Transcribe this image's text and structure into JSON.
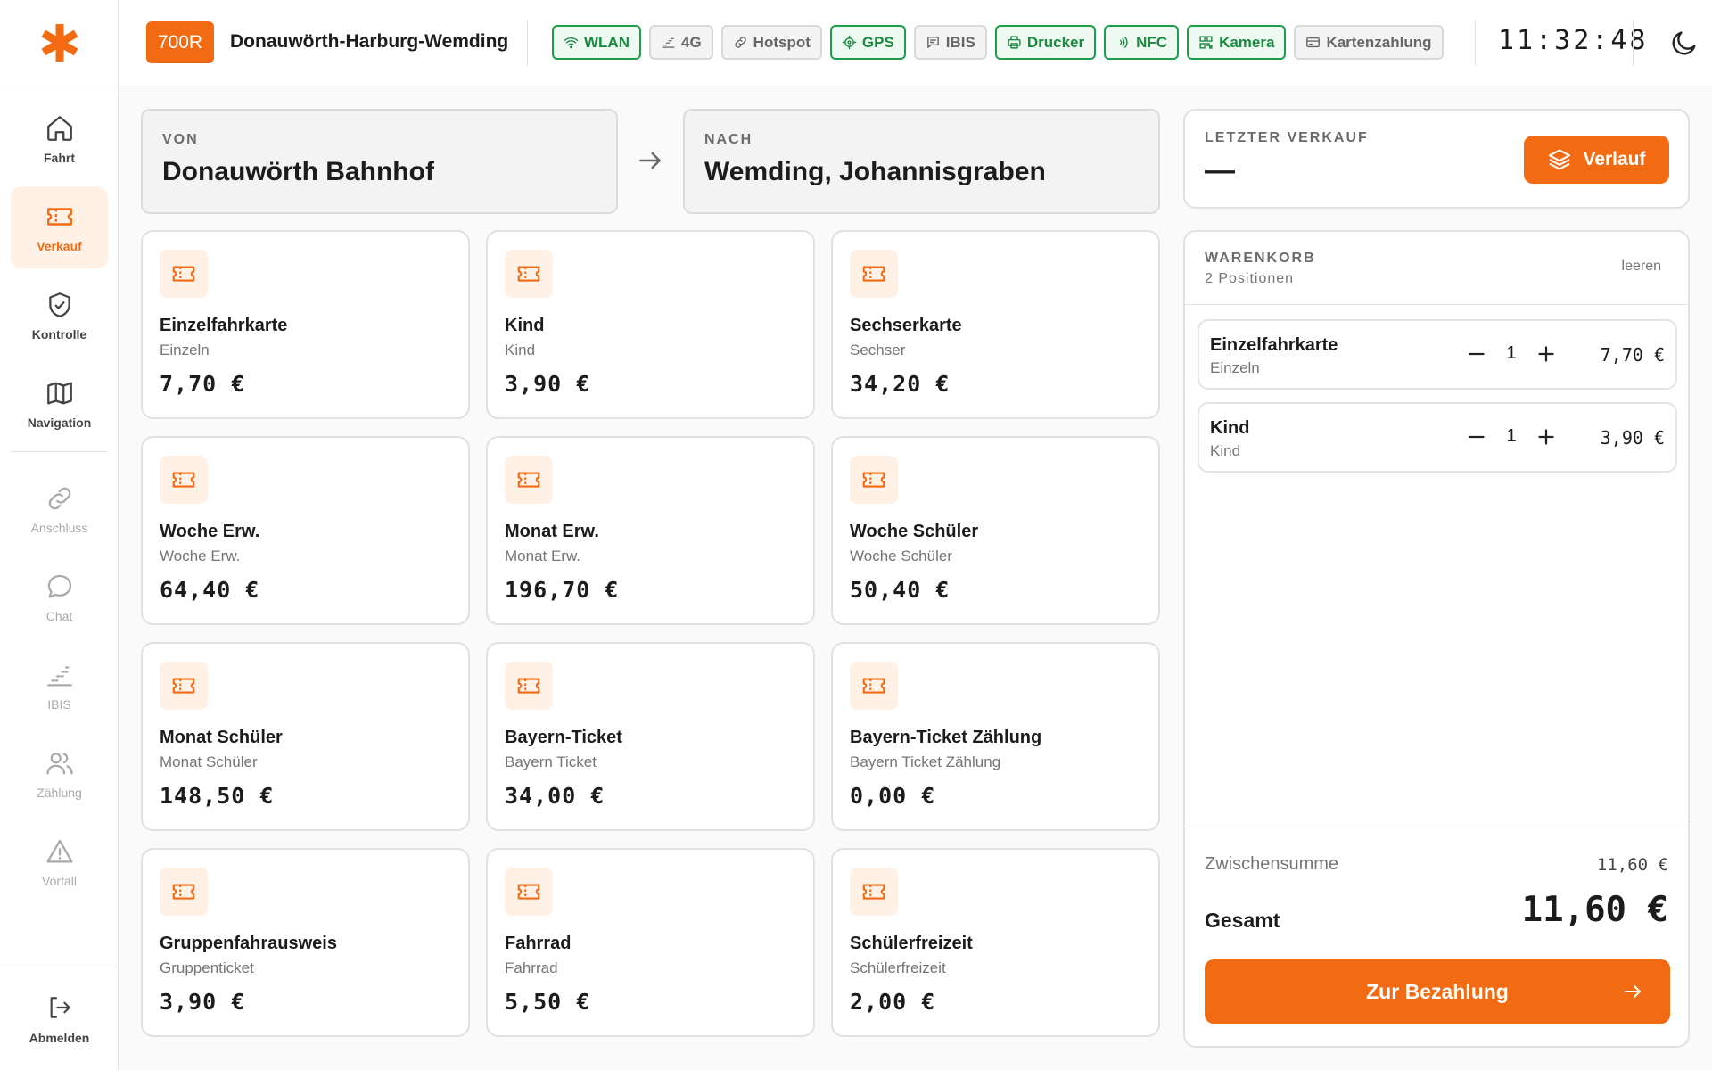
{
  "sidebar": {
    "items": [
      {
        "label": "Fahrt",
        "icon": "home-icon"
      },
      {
        "label": "Verkauf",
        "icon": "ticket-icon"
      },
      {
        "label": "Kontrolle",
        "icon": "shield-check-icon"
      },
      {
        "label": "Navigation",
        "icon": "map-icon"
      },
      {
        "label": "Anschluss",
        "icon": "link-icon"
      },
      {
        "label": "Chat",
        "icon": "chat-bubble-icon"
      },
      {
        "label": "IBIS",
        "icon": "signal-icon"
      },
      {
        "label": "Zählung",
        "icon": "users-icon"
      },
      {
        "label": "Vorfall",
        "icon": "warning-icon"
      }
    ],
    "logout": "Abmelden"
  },
  "header": {
    "line": "700R",
    "route": "Donauwörth-Harburg-Wemding",
    "status": [
      {
        "label": "WLAN",
        "on": true,
        "icon": "wifi-icon"
      },
      {
        "label": "4G",
        "on": false,
        "icon": "signal-bars-icon"
      },
      {
        "label": "Hotspot",
        "on": false,
        "icon": "link-icon"
      },
      {
        "label": "GPS",
        "on": true,
        "icon": "crosshair-icon"
      },
      {
        "label": "IBIS",
        "on": false,
        "icon": "message-icon"
      },
      {
        "label": "Drucker",
        "on": true,
        "icon": "printer-icon"
      },
      {
        "label": "NFC",
        "on": true,
        "icon": "nfc-icon"
      },
      {
        "label": "Kamera",
        "on": true,
        "icon": "qr-icon"
      },
      {
        "label": "Kartenzahlung",
        "on": false,
        "icon": "card-icon"
      }
    ],
    "clock": "11:32:48"
  },
  "route": {
    "from_label": "VON",
    "from": "Donauwörth Bahnhof",
    "to_label": "NACH",
    "to": "Wemding, Johannisgraben"
  },
  "tickets": [
    {
      "name": "Einzelfahrkarte",
      "sub": "Einzeln",
      "price": "7,70 €"
    },
    {
      "name": "Kind",
      "sub": "Kind",
      "price": "3,90 €"
    },
    {
      "name": "Sechserkarte",
      "sub": "Sechser",
      "price": "34,20 €"
    },
    {
      "name": "Woche Erw.",
      "sub": "Woche Erw.",
      "price": "64,40 €"
    },
    {
      "name": "Monat Erw.",
      "sub": "Monat Erw.",
      "price": "196,70 €"
    },
    {
      "name": "Woche Schüler",
      "sub": "Woche Schüler",
      "price": "50,40 €"
    },
    {
      "name": "Monat Schüler",
      "sub": "Monat Schüler",
      "price": "148,50 €"
    },
    {
      "name": "Bayern-Ticket",
      "sub": "Bayern Ticket",
      "price": "34,00 €"
    },
    {
      "name": "Bayern-Ticket Zählung",
      "sub": "Bayern Ticket Zählung",
      "price": "0,00 €"
    },
    {
      "name": "Gruppenfahrausweis",
      "sub": "Gruppenticket",
      "price": "3,90 €"
    },
    {
      "name": "Fahrrad",
      "sub": "Fahrrad",
      "price": "5,50 €"
    },
    {
      "name": "Schülerfreizeit",
      "sub": "Schülerfreizeit",
      "price": "2,00 €"
    }
  ],
  "last_sale": {
    "label": "LETZTER VERKAUF",
    "value": "—",
    "history_button": "Verlauf"
  },
  "cart": {
    "title": "WARENKORB",
    "count": "2 Positionen",
    "clear": "leeren",
    "items": [
      {
        "name": "Einzelfahrkarte",
        "sub": "Einzeln",
        "qty": "1",
        "price": "7,70 €"
      },
      {
        "name": "Kind",
        "sub": "Kind",
        "qty": "1",
        "price": "3,90 €"
      }
    ],
    "subtotal_label": "Zwischensumme",
    "subtotal": "11,60 €",
    "total_label": "Gesamt",
    "total": "11,60 €",
    "pay_button": "Zur Bezahlung"
  },
  "colors": {
    "accent": "#f26b12",
    "accent_soft": "#fff1e6",
    "status_on": "#1a8a40"
  }
}
